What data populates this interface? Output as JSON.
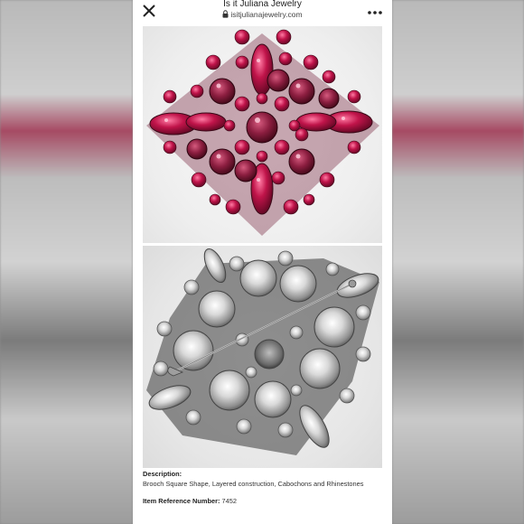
{
  "header": {
    "title": "Is it Juliana Jewelry",
    "url": "isitjulianajewelry.com"
  },
  "product": {
    "description_label": "Description:",
    "description_text": "Brooch Square Shape, Layered construction, Cabochons and Rhinestones",
    "reference_label": "Item Reference Number:",
    "reference_value": "7452"
  },
  "icons": {
    "close": "close-icon",
    "lock": "lock-icon",
    "menu": "more-horizontal-icon"
  },
  "colors": {
    "stone_ruby": "#b0123f",
    "stone_pink": "#e03a6d",
    "metal_silver": "#c8c8c8",
    "background": "#ffffff"
  }
}
